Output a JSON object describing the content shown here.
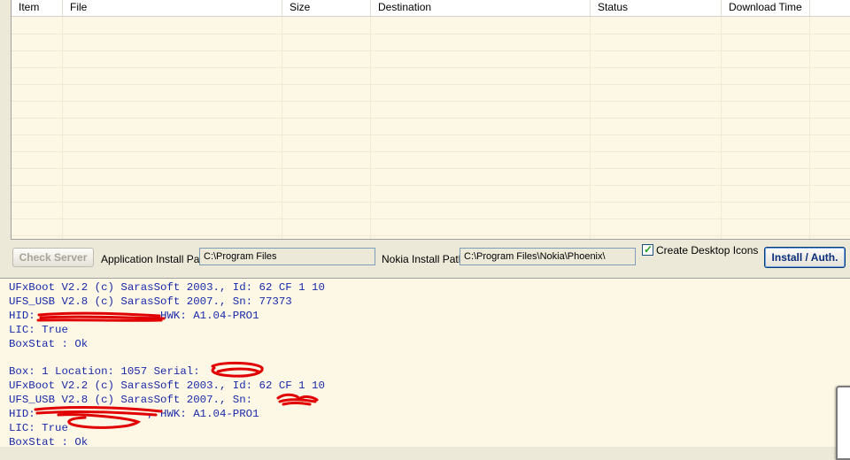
{
  "table": {
    "columns": [
      "Item",
      "File",
      "Size",
      "Destination",
      "Status",
      "Download Time"
    ],
    "rows": []
  },
  "toolbar": {
    "check_server_label": "Check Server",
    "app_path_label": "Application Install Path",
    "app_path_value": "C:\\Program Files",
    "nokia_path_label": "Nokia Install Path",
    "nokia_path_value": "C:\\Program Files\\Nokia\\Phoenix\\",
    "desktop_icons_label": "Create Desktop Icons",
    "desktop_icons_checked": true,
    "install_label": "Install / Auth."
  },
  "log": {
    "lines": [
      "UFxBoot V2.2 (c) SarasSoft 2003., Id: 62 CF 1 10",
      "UFS_USB V2.8 (c) SarasSoft 2007., Sn: 77373",
      "HID:                 , HWK: A1.04-PRO1",
      "LIC: True",
      "BoxStat : Ok",
      "",
      "Box: 1 Location: 1057 Serial:",
      "UFxBoot V2.2 (c) SarasSoft 2003., Id: 62 CF 1 10",
      "UFS_USB V2.8 (c) SarasSoft 2007., Sn:",
      "HID:                 , HWK: A1.04-PRO1",
      "LIC: True",
      "BoxStat : Ok"
    ]
  },
  "colors": {
    "log_text": "#1a2aa8",
    "redaction": "#e00000",
    "list_background": "#fdf8e6"
  }
}
